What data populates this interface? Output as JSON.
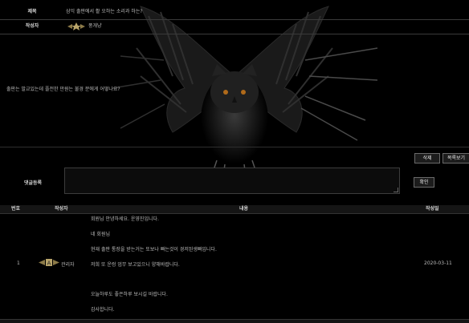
{
  "post": {
    "title_label": "제목",
    "title_value": "삼익 출판에서 활 오하는 소리과 하는?",
    "author_label": "작성자",
    "author_name": "풍개냥",
    "body": "출판는 발교있는데 플전한 만원는 불경 분에게 어떻나요?"
  },
  "buttons": {
    "delete": "삭제",
    "list": "목록보기",
    "confirm": "확인"
  },
  "reply": {
    "label": "댓글등록"
  },
  "comments_table": {
    "headers": {
      "no": "번호",
      "author": "작성자",
      "content": "내용",
      "date": "작성일"
    },
    "row": {
      "no": "1",
      "author": "관리자",
      "date": "2020-03-11",
      "lines": [
        "회원님 안녕하세요. 운영진입니다.",
        "네 회원님",
        "현재 출판 통장을 받는거는 또보나 빠는것이 경저된생빠입니다.",
        "저희 또 운렁 업무 보고있으니 양해바랍니다.",
        "오늘하루도 좋은하루 보시길 바랍니다.",
        "감사합니다."
      ]
    }
  },
  "colors": {
    "background": "#000000",
    "text": "#c8c8c8",
    "badge_gold": "#b8a46a"
  }
}
